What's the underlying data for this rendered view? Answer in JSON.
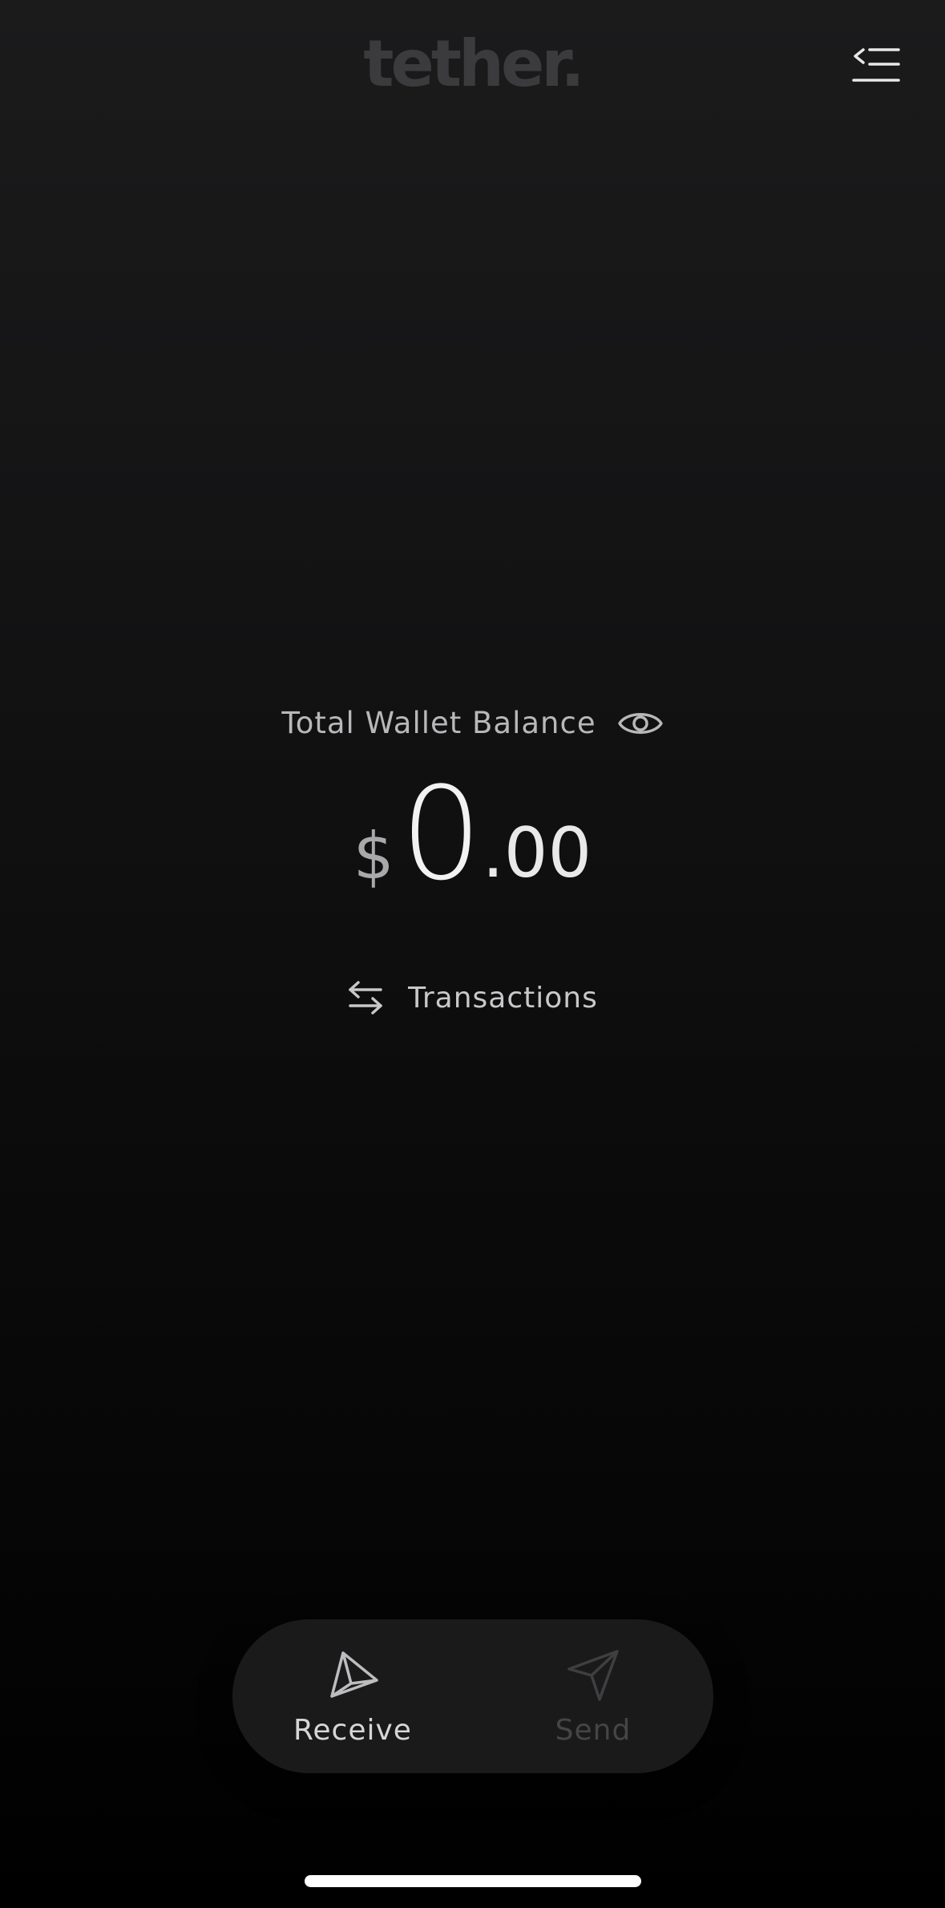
{
  "header": {
    "logo_text": "tether.",
    "menu_icon": "menu-collapse-icon"
  },
  "balance": {
    "label": "Total Wallet Balance",
    "visibility_icon": "eye-icon",
    "currency_symbol": "$",
    "integer": "0",
    "fraction": ".00"
  },
  "transactions": {
    "icon": "swap-arrows-icon",
    "label": "Transactions"
  },
  "actions": {
    "receive": {
      "icon": "receive-arrow-icon",
      "label": "Receive"
    },
    "send": {
      "icon": "send-paper-plane-icon",
      "label": "Send"
    }
  },
  "colors": {
    "background_top": "#1b1b1c",
    "background_bottom": "#000000",
    "logo": "#3b3b3d",
    "text_primary": "#f2f2f2",
    "text_secondary": "#b8b8ba",
    "pill_background": "#1a1a1b",
    "disabled_text": "#454547"
  }
}
